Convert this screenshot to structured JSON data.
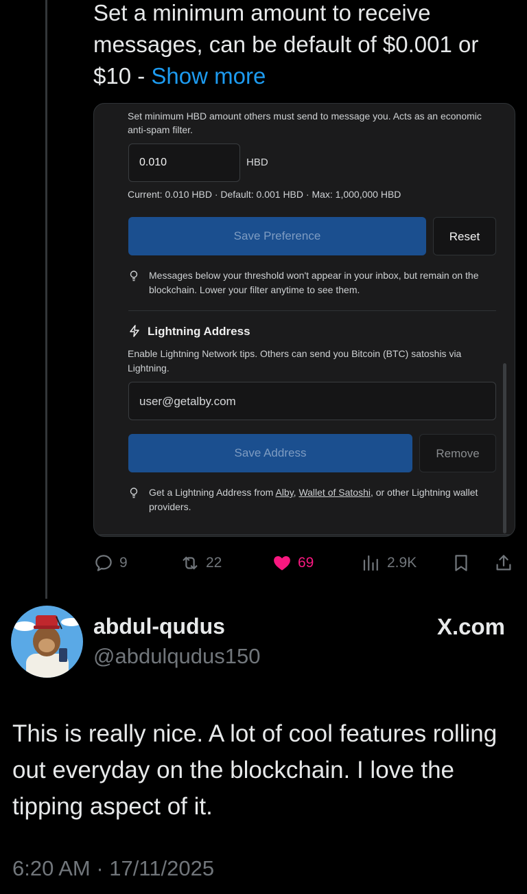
{
  "tweet1": {
    "text": "Set a minimum amount to receive messages, can be default of $0.001 or $10 - ",
    "show_more": "Show more"
  },
  "card": {
    "description": "Set minimum HBD amount others must send to message you. Acts as an economic anti-spam filter.",
    "amount_value": "0.010",
    "amount_unit": "HBD",
    "current_line": "Current: 0.010 HBD · Default: 0.001 HBD · Max: 1,000,000 HBD",
    "save_pref_label": "Save Preference",
    "reset_label": "Reset",
    "threshold_tip": "Messages below your threshold won't appear in your inbox, but remain on the blockchain. Lower your filter anytime to see them.",
    "lightning_title": "Lightning Address",
    "lightning_desc": "Enable Lightning Network tips. Others can send you Bitcoin (BTC) satoshis via Lightning.",
    "address_value": "user@getalby.com",
    "save_addr_label": "Save Address",
    "remove_label": "Remove",
    "tip2_prefix": "Get a Lightning Address from ",
    "tip2_link1": "Alby",
    "tip2_sep": ", ",
    "tip2_link2": "Wallet of Satoshi",
    "tip2_suffix": ", or other Lightning wallet providers."
  },
  "actions": {
    "replies": "9",
    "retweets": "22",
    "likes": "69",
    "views": "2.9K",
    "reply_icon": "reply-icon",
    "retweet_icon": "retweet-icon",
    "like_icon": "heart-icon",
    "views_icon": "views-icon",
    "bookmark_icon": "bookmark-icon",
    "share_icon": "share-icon"
  },
  "reply": {
    "name": "abdul-qudus",
    "handle": "@abdulqudus150",
    "source": "X.com",
    "text": "This is really nice. A lot of cool features rolling out everyday on the blockchain. I love the tipping aspect of it.",
    "timestamp": "6:20 AM · 17/11/2025"
  },
  "colors": {
    "background": "#000000",
    "link": "#1d9bf0",
    "like": "#f91880",
    "muted": "#71767b",
    "button_blue": "#1b4f8f"
  }
}
